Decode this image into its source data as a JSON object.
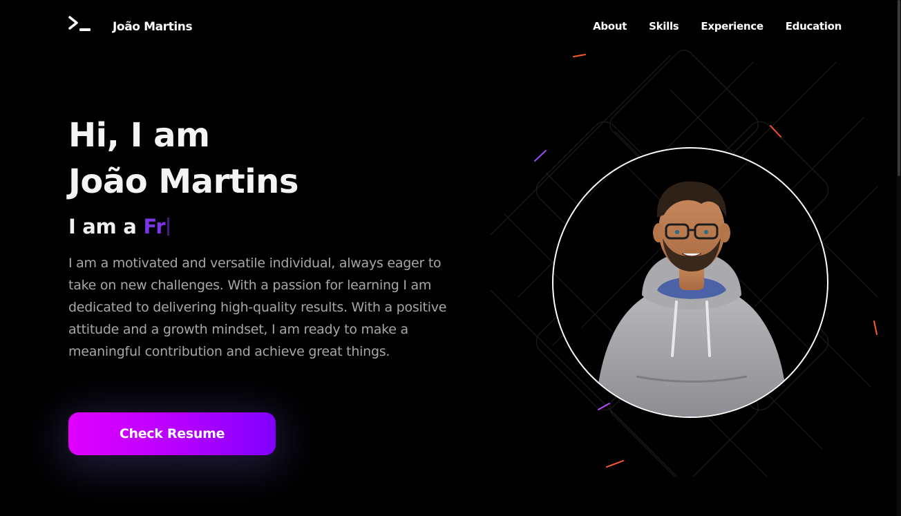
{
  "header": {
    "logo_icon": "terminal-prompt-icon",
    "brand": "João Martins",
    "nav": [
      {
        "label": "About"
      },
      {
        "label": "Skills"
      },
      {
        "label": "Experience"
      },
      {
        "label": "Education"
      }
    ]
  },
  "hero": {
    "line1": "Hi, I am",
    "line2": "João Martins",
    "role_prefix": "I am a",
    "role_typed": "Fr",
    "bio": "I am a motivated and versatile individual, always eager to take on new challenges. With a passion for learning I am dedicated to delivering high-quality results. With a positive attitude and a growth mindset, I am ready to make a meaningful contribution and achieve great things.",
    "cta_label": "Check Resume"
  },
  "colors": {
    "background": "#000000",
    "accent_purple": "#7b35e8",
    "cta_gradient_start": "#e100ff",
    "cta_gradient_end": "#7f00ff",
    "text_muted": "#a7a7a7"
  },
  "avatar": {
    "icon": "cartoon-avatar-portrait"
  }
}
